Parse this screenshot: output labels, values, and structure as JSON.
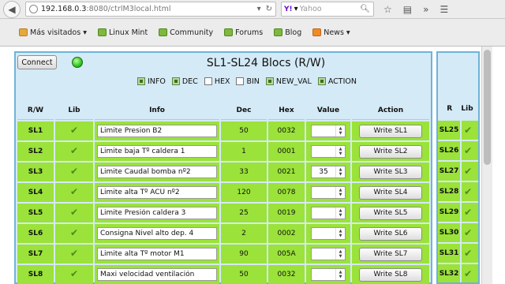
{
  "browser": {
    "url_host": "192.168.0.3",
    "url_rest": ":8080/ctrlM3local.html",
    "search_engine": "Yahoo",
    "search_placeholder": "Yahoo"
  },
  "bookmarks": [
    {
      "label": "Más visitados ▾",
      "icon": "folder-icon"
    },
    {
      "label": "Linux Mint",
      "icon": "page-icon"
    },
    {
      "label": "Community",
      "icon": "page-icon"
    },
    {
      "label": "Forums",
      "icon": "page-icon"
    },
    {
      "label": "Blog",
      "icon": "page-icon"
    },
    {
      "label": "News ▾",
      "icon": "rss-icon"
    }
  ],
  "panel": {
    "connect_label": "Connect",
    "title": "SL1-SL24 Blocs (R/W)",
    "options": [
      {
        "label": "INFO",
        "checked": true
      },
      {
        "label": "DEC",
        "checked": true
      },
      {
        "label": "HEX",
        "checked": false
      },
      {
        "label": "BIN",
        "checked": false
      },
      {
        "label": "NEW_VAL",
        "checked": true
      },
      {
        "label": "ACTION",
        "checked": true
      }
    ],
    "columns": [
      "R/W",
      "Lib",
      "Info",
      "Dec",
      "Hex",
      "Value",
      "Action"
    ],
    "rows": [
      {
        "sl": "SL1",
        "info": "Limite Presion B2",
        "dec": "50",
        "hex": "0032",
        "value": "",
        "action": "Write SL1"
      },
      {
        "sl": "SL2",
        "info": "Limite baja Tº caldera 1",
        "dec": "1",
        "hex": "0001",
        "value": "",
        "action": "Write SL2"
      },
      {
        "sl": "SL3",
        "info": "Limite Caudal bomba nº2",
        "dec": "33",
        "hex": "0021",
        "value": "35",
        "action": "Write SL3"
      },
      {
        "sl": "SL4",
        "info": "Limite alta Tº ACU nº2",
        "dec": "120",
        "hex": "0078",
        "value": "",
        "action": "Write SL4"
      },
      {
        "sl": "SL5",
        "info": "Limite Presión caldera 3",
        "dec": "25",
        "hex": "0019",
        "value": "",
        "action": "Write SL5"
      },
      {
        "sl": "SL6",
        "info": "Consigna Nivel alto dep. 4",
        "dec": "2",
        "hex": "0002",
        "value": "",
        "action": "Write SL6"
      },
      {
        "sl": "SL7",
        "info": "Limite alta Tº motor M1",
        "dec": "90",
        "hex": "005A",
        "value": "",
        "action": "Write SL7"
      },
      {
        "sl": "SL8",
        "info": "Maxi velocidad ventilación",
        "dec": "50",
        "hex": "0032",
        "value": "",
        "action": "Write SL8"
      }
    ]
  },
  "panel2": {
    "columns": [
      "R",
      "Lib"
    ],
    "rows": [
      "SL25",
      "SL26",
      "SL27",
      "SL28",
      "SL29",
      "SL30",
      "SL31",
      "SL32"
    ]
  },
  "colors": {
    "row_green": "#9be23a",
    "panel_blue": "#d4eaf6",
    "panel_border": "#70b3d6"
  }
}
